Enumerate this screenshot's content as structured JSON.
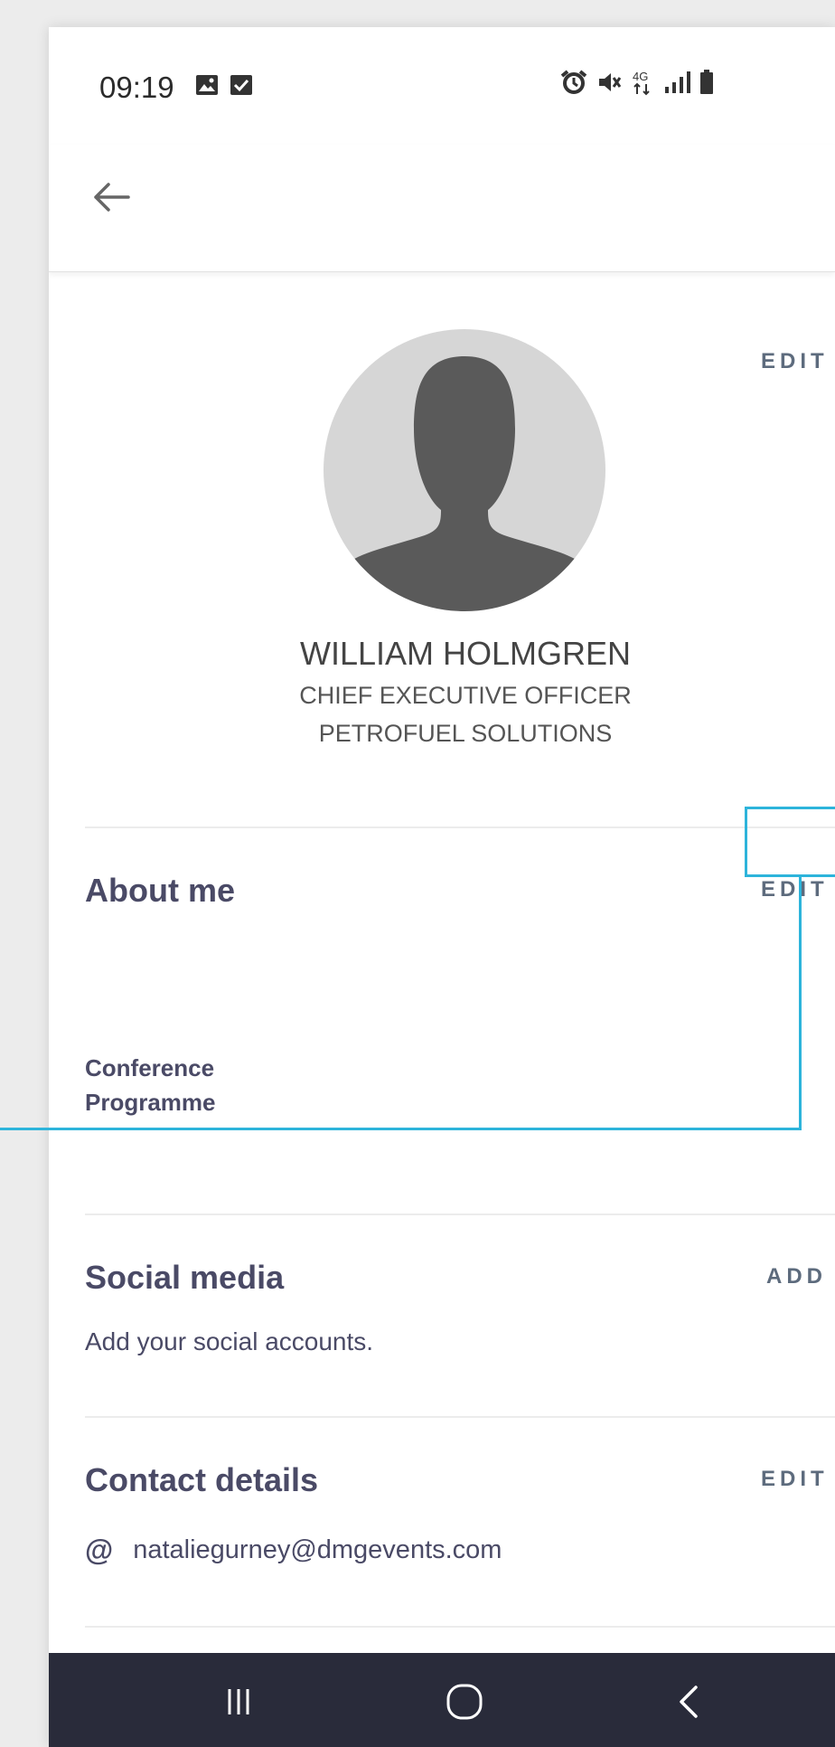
{
  "status_bar": {
    "time": "09:19",
    "icons": [
      "image-icon",
      "checkbox-icon",
      "alarm-icon",
      "mute-icon",
      "4g-icon",
      "signal-icon",
      "battery-icon"
    ],
    "network": "4G"
  },
  "app_bar": {
    "back_icon": "arrow-left-icon"
  },
  "profile": {
    "name": "WILLIAM HOLMGREN",
    "title": "CHIEF EXECUTIVE OFFICER",
    "company": "PETROFUEL SOLUTIONS",
    "edit_label": "EDIT"
  },
  "about": {
    "title": "About me",
    "edit_label": "EDIT",
    "conference_link": "Conference Programme"
  },
  "social": {
    "title": "Social media",
    "action_label": "ADD",
    "description": "Add your social accounts."
  },
  "contact": {
    "title": "Contact details",
    "edit_label": "EDIT",
    "email_icon": "@",
    "email": "nataliegurney@dmgevents.com"
  },
  "nav_bar": {
    "icons": [
      "recent-apps-icon",
      "home-icon",
      "back-icon"
    ]
  },
  "colors": {
    "highlight": "#2db4db",
    "text": "#4a4a66",
    "nav_bg": "#292b3a"
  }
}
